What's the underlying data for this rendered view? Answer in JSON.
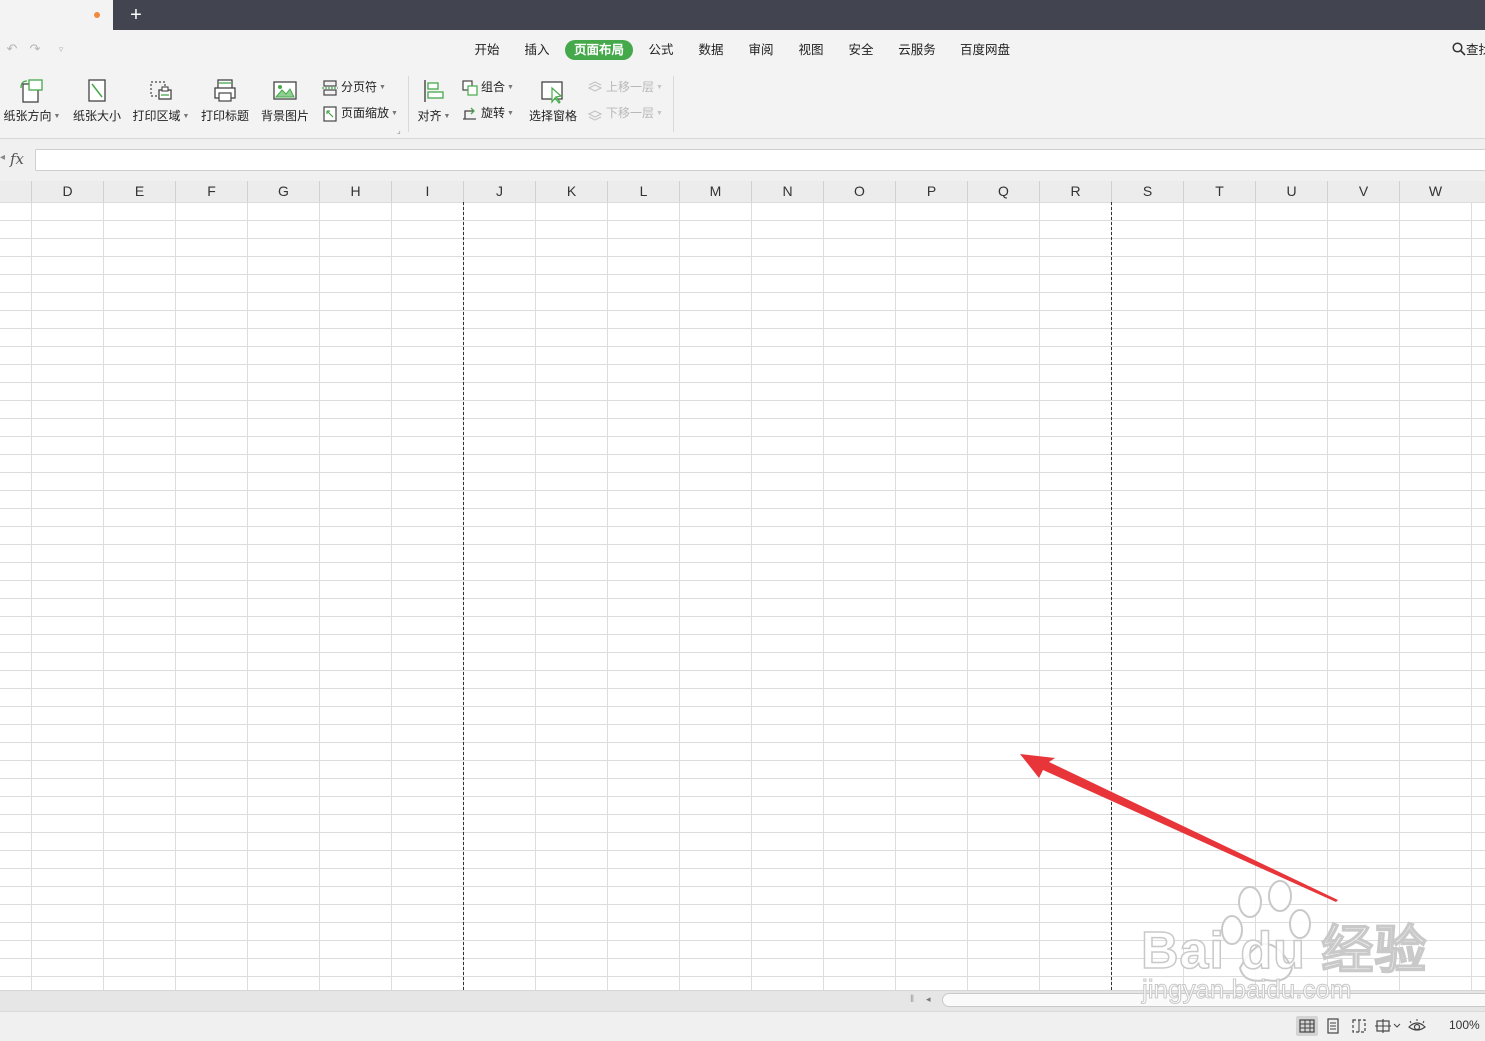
{
  "tabs": {
    "new_tab": "+"
  },
  "menu": {
    "items": [
      "开始",
      "插入",
      "页面布局",
      "公式",
      "数据",
      "审阅",
      "视图",
      "安全",
      "云服务",
      "百度网盘"
    ],
    "active": "页面布局",
    "search": "查找"
  },
  "ribbon": {
    "orientation": "纸张方向",
    "size": "纸张大小",
    "print_area": "打印区域",
    "print_titles": "打印标题",
    "background": "背景图片",
    "page_break": "分页符",
    "page_zoom": "页面缩放",
    "align": "对齐",
    "group": "组合",
    "rotate": "旋转",
    "selection_pane": "选择窗格",
    "bring_forward": "上移一层",
    "send_backward": "下移一层"
  },
  "formula": {
    "fx": "fx",
    "value": ""
  },
  "columns": [
    "D",
    "E",
    "F",
    "G",
    "H",
    "I",
    "J",
    "K",
    "L",
    "M",
    "N",
    "O",
    "P",
    "Q",
    "R",
    "S",
    "T",
    "U",
    "V",
    "W"
  ],
  "status": {
    "zoom": "100%"
  },
  "watermark": {
    "brand": "Bai du 经验",
    "url": "jingyan.baidu.com"
  },
  "colors": {
    "accent": "#45a84a",
    "arrow": "#e8353a",
    "titlebar": "#42444f",
    "tab_dot": "#f08a3c"
  }
}
